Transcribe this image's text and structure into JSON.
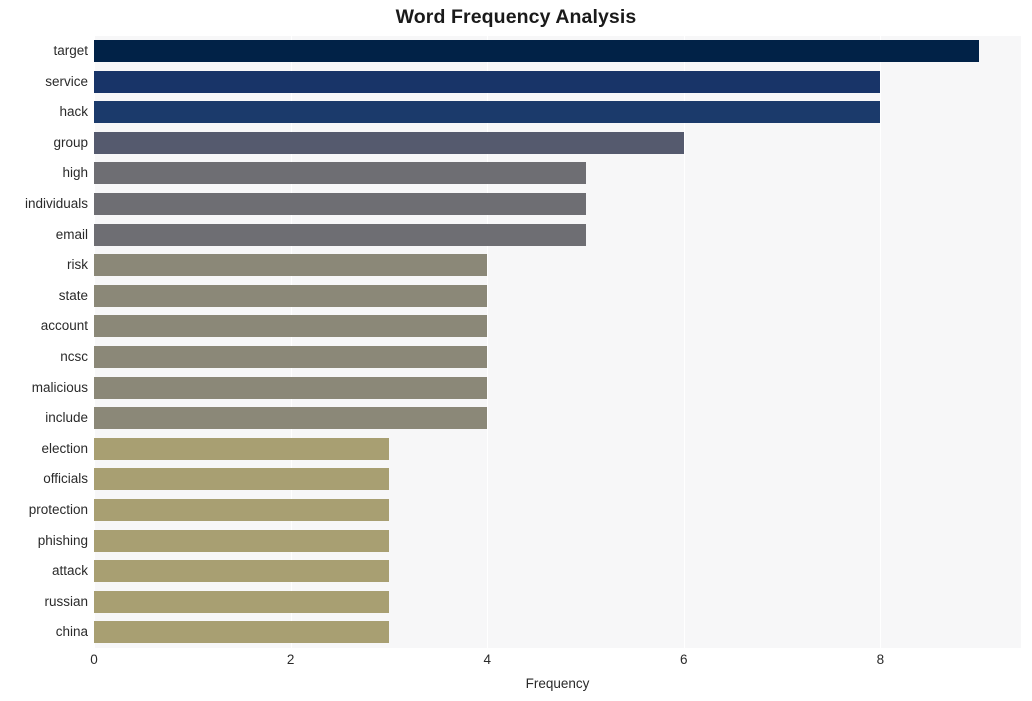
{
  "chart_data": {
    "type": "bar",
    "orientation": "horizontal",
    "title": "Word Frequency Analysis",
    "xlabel": "Frequency",
    "ylabel": "",
    "xlim": [
      0,
      9.43
    ],
    "xticks": [
      0,
      2,
      4,
      6,
      8
    ],
    "xtick_labels": [
      "0",
      "2",
      "4",
      "6",
      "8"
    ],
    "grid": "vertical-only",
    "legend": "none",
    "categories": [
      "target",
      "service",
      "hack",
      "group",
      "high",
      "individuals",
      "email",
      "risk",
      "state",
      "account",
      "ncsc",
      "malicious",
      "include",
      "election",
      "officials",
      "protection",
      "phishing",
      "attack",
      "russian",
      "china"
    ],
    "values": [
      9,
      8,
      8,
      6,
      5,
      5,
      5,
      4,
      4,
      4,
      4,
      4,
      4,
      3,
      3,
      3,
      3,
      3,
      3,
      3
    ],
    "bar_colors": [
      "#012247",
      "#183468",
      "#1b3a6b",
      "#555a6e",
      "#6e6e73",
      "#6e6e73",
      "#6e6e73",
      "#8b8878",
      "#8b8878",
      "#8b8878",
      "#8b8878",
      "#8b8878",
      "#8b8878",
      "#a89f72",
      "#a89f72",
      "#a89f72",
      "#a89f72",
      "#a89f72",
      "#a89f72",
      "#a89f72"
    ],
    "plot_background": "#f7f7f8",
    "gridline_color": "#ffffff",
    "figure_background": "#ffffff",
    "text_color": "#2a2a2a"
  }
}
